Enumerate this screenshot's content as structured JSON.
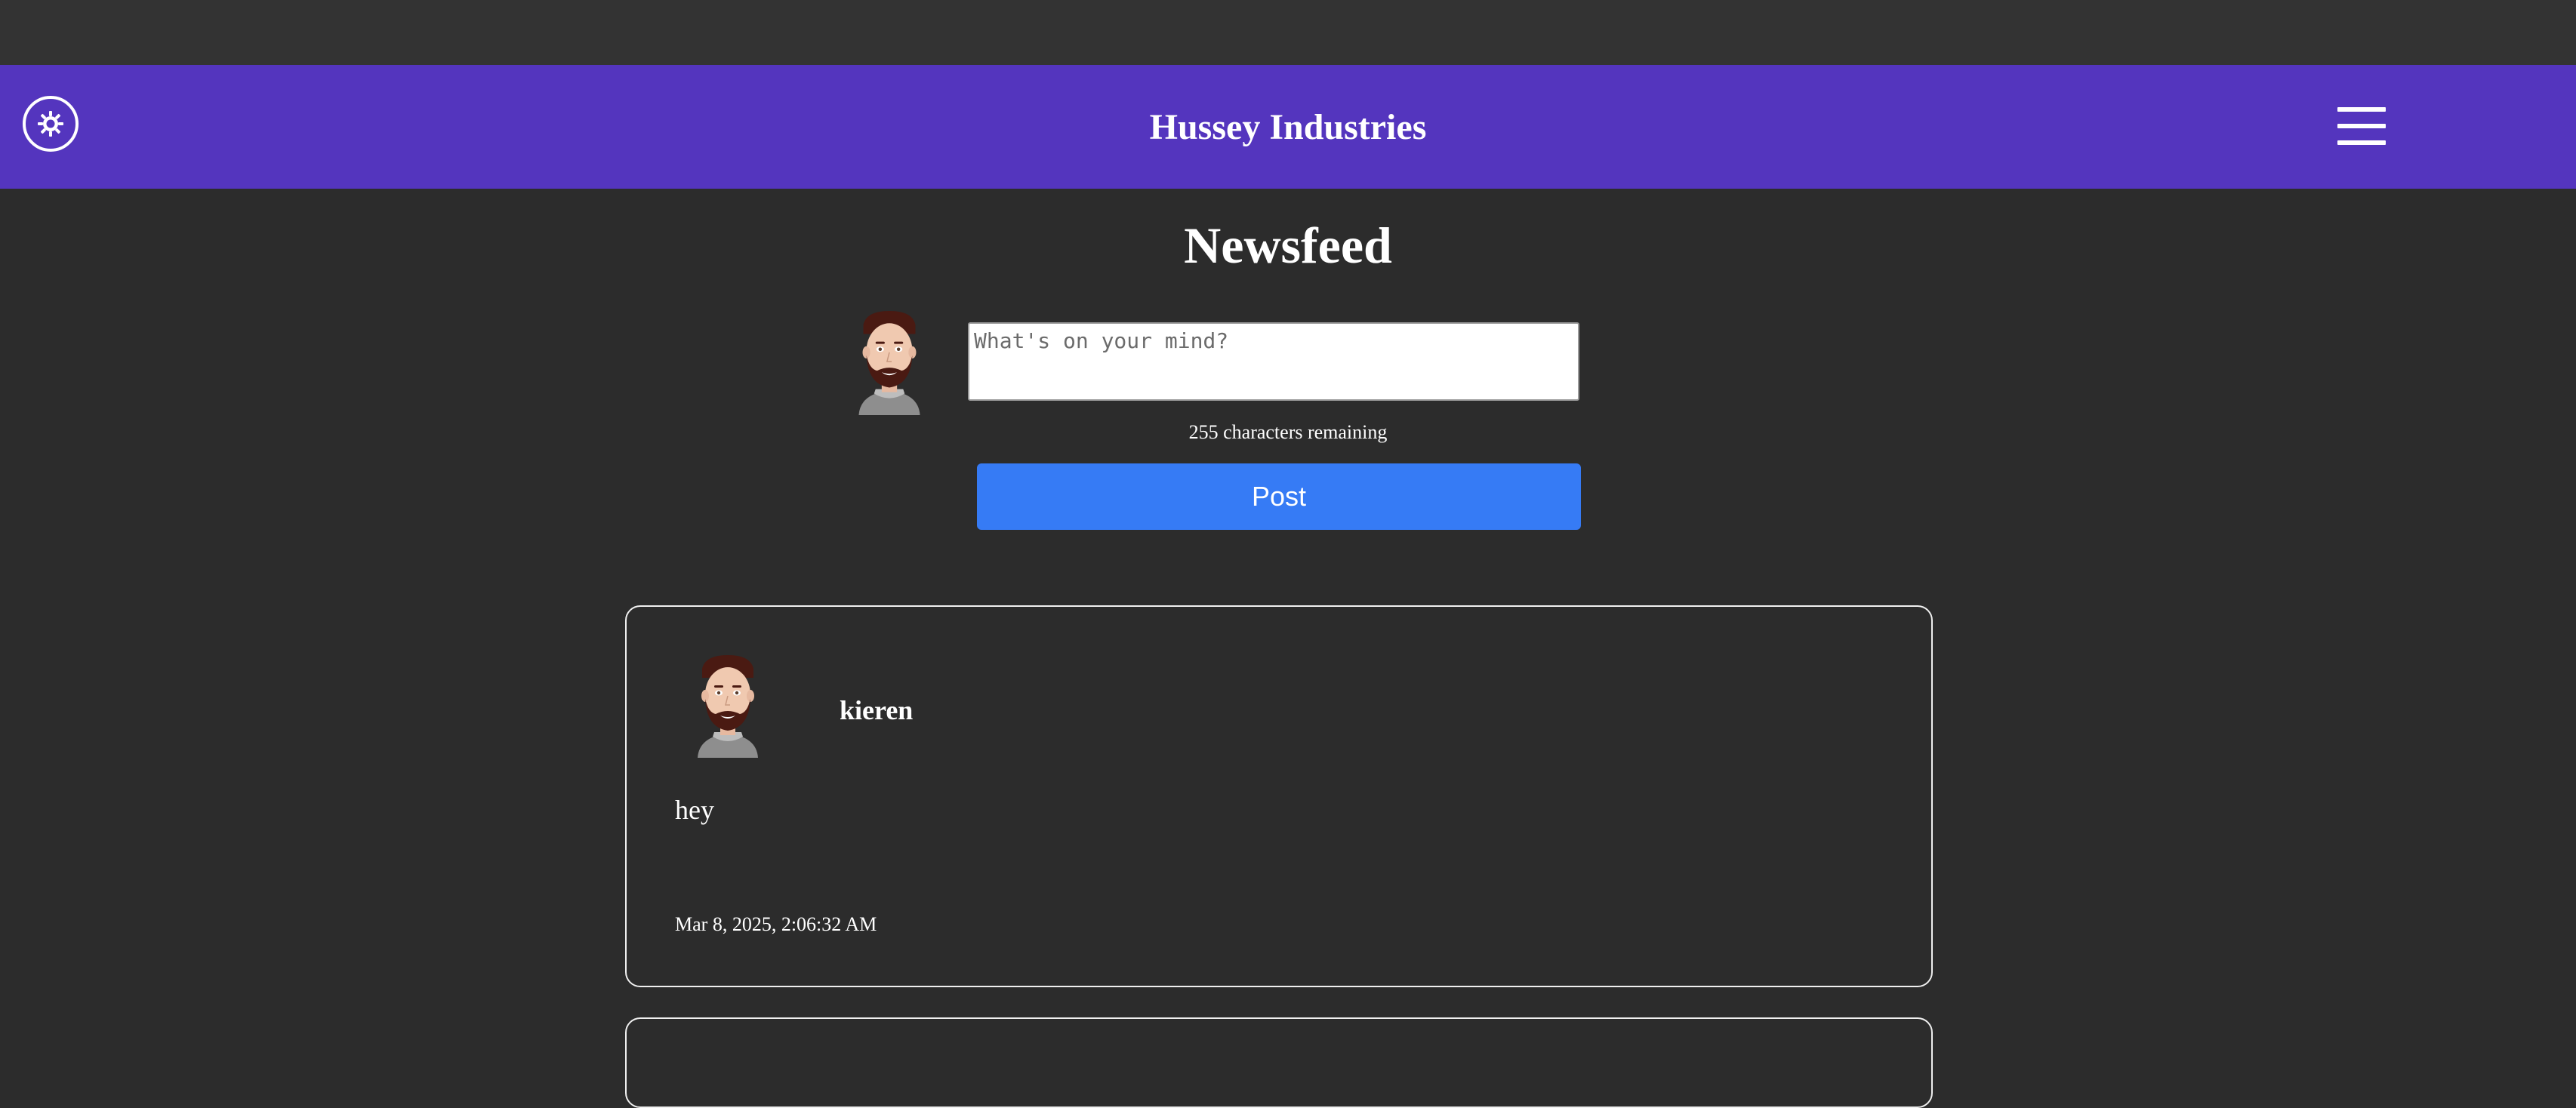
{
  "navbar": {
    "brand": "Hussey Industries",
    "theme_toggle_icon": "sun-icon",
    "menu_icon": "hamburger-menu-icon",
    "color": "#5435be"
  },
  "page": {
    "title": "Newsfeed"
  },
  "composer": {
    "placeholder": "What's on your mind?",
    "value": "",
    "chars_remaining": "255 characters remaining",
    "post_label": "Post",
    "post_color": "#367bf5"
  },
  "posts": [
    {
      "author": "kieren",
      "body": "hey",
      "timestamp": "Mar 8, 2025, 2:06:32 AM"
    }
  ]
}
